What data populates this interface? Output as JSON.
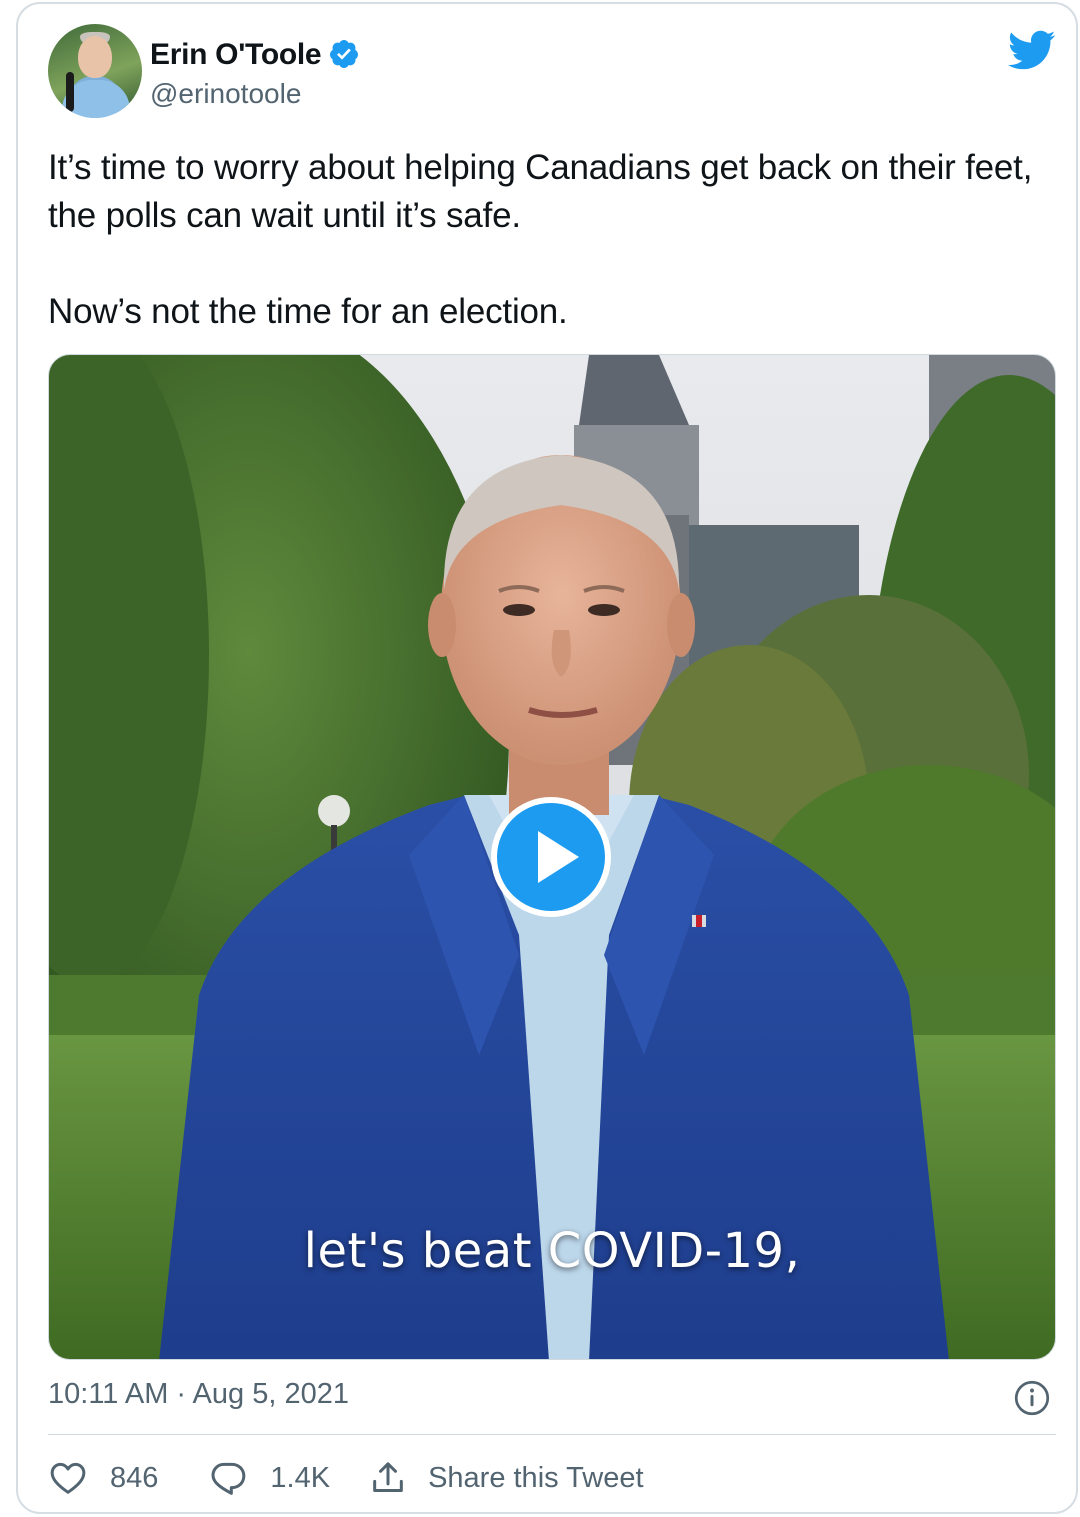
{
  "author": {
    "name": "Erin O'Toole",
    "handle": "@erinotoole",
    "verified": true
  },
  "tweet": {
    "text": "It’s time to worry about helping Canadians get back on their feet, the polls can wait until it’s safe.\n\nNow’s not the time for an election."
  },
  "media": {
    "type": "video",
    "caption": "let's beat COVID-19,"
  },
  "meta": {
    "timestamp": "10:11 AM · Aug 5, 2021"
  },
  "actions": {
    "likes": "846",
    "replies": "1.4K",
    "share_label": "Share this Tweet"
  },
  "icons": {
    "brand": "twitter-bird-icon",
    "verified": "verified-badge-icon",
    "play": "play-icon",
    "info": "info-icon",
    "like": "heart-icon",
    "reply": "reply-icon",
    "share": "share-icon"
  },
  "colors": {
    "accent": "#1d9bf0",
    "text_primary": "#0f1419",
    "text_secondary": "#536471",
    "border": "#cfd9de"
  }
}
